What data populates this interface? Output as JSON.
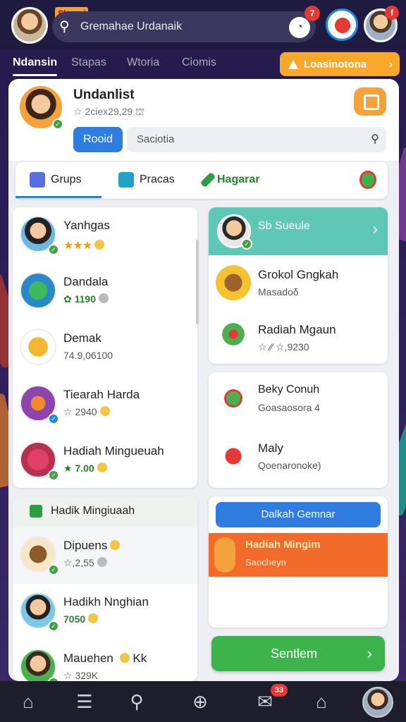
{
  "colors": {
    "accent_blue": "#2f7de0",
    "teal": "#5ec7b6",
    "orange": "#f8a82b",
    "green": "#3cb44b",
    "badge_red": "#e53935"
  },
  "topbar": {
    "badge": "Sbpcai",
    "search_text": "Gremahae Urdanaik",
    "bell_count": "7",
    "avatar2_count": "f"
  },
  "tabs": [
    "Ndansin",
    "Stapas",
    "Wtoria",
    "Ciomis"
  ],
  "tab_cta": "Loasinotona",
  "profile": {
    "name": "Undanlist",
    "sub": "☆ 2ciex29,29 ⛫",
    "role_button": "Rooid",
    "search_placeholder": "Saciotia"
  },
  "categories": [
    {
      "label": "Grups",
      "icon": "house-icon",
      "color": "#5b6ee1"
    },
    {
      "label": "Pracas",
      "icon": "picture-icon",
      "color": "#20a3c8"
    },
    {
      "label": "Hagarar",
      "icon": "pencil-icon",
      "color": "#2e9e44"
    }
  ],
  "left_list": [
    {
      "name": "Yanhgas",
      "sub": "★★★",
      "coin": "10"
    },
    {
      "name": "Dandala",
      "sub": "✿ 1190"
    },
    {
      "name": "Demak",
      "sub": "74.9,06100"
    },
    {
      "name": "Tiearah Harda",
      "sub": "☆ 2940"
    },
    {
      "name": "Hadiah Mingueuah",
      "sub": "★ 7.00"
    }
  ],
  "right_top": {
    "header": "Sb Sueule",
    "items": [
      {
        "name": "Grokol Gngkah",
        "sub": "Masadoδ"
      },
      {
        "name": "Radiah Mgaun",
        "sub": "☆ ⁄⁄ ☆,9230"
      }
    ]
  },
  "right_mid": {
    "items": [
      {
        "name": "Beky Conuh",
        "sub": "Goasaosora 4"
      },
      {
        "name": "Maly",
        "sub": "Qoenaronoke)"
      }
    ]
  },
  "left_bottom": {
    "header": "Hadik Mingiuaah",
    "items": [
      {
        "name": "Dipuens",
        "sub": "☆,2,55"
      },
      {
        "name": "Hadikh Nnghian",
        "sub": "7050"
      },
      {
        "name": "Mauehen",
        "sub": "☆ 329K",
        "extra": "Kk"
      }
    ]
  },
  "right_bottom": {
    "button": "Dalkah Gemnar",
    "promo_title": "Hadiah Mingim",
    "promo_sub": "Saocheyn"
  },
  "cta_green": "Sentlem",
  "bottom_nav": {
    "badge": "33"
  }
}
